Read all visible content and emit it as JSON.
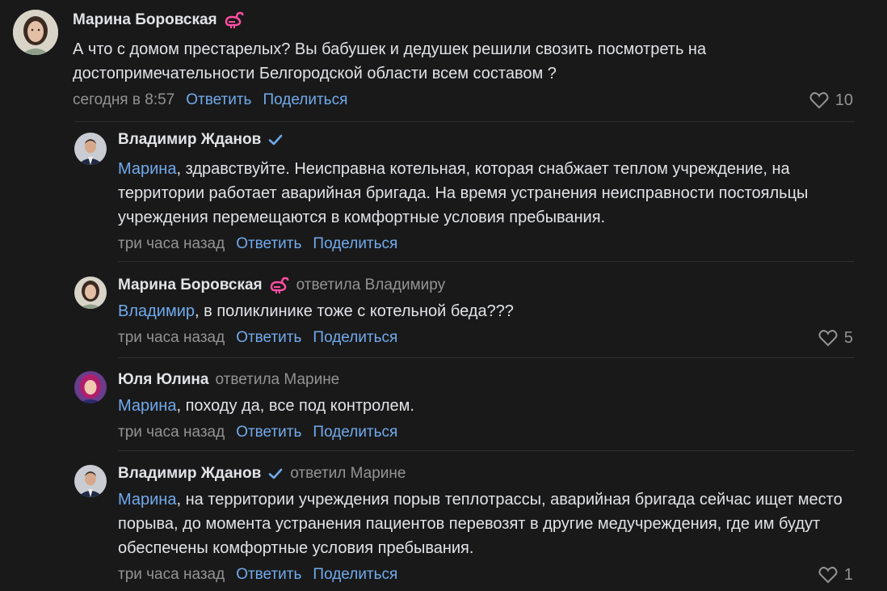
{
  "comments": [
    {
      "author": "Марина Боровская",
      "reply_to": "",
      "mention": "",
      "text": "А что с домом престарелых? Вы бабушек и дедушек решили свозить посмотреть на достопримечательности Белгородской области всем составом ?",
      "time": "сегодня в 8:57",
      "reply_label": "Ответить",
      "share_label": "Поделиться",
      "likes": "10"
    },
    {
      "author": "Владимир Жданов",
      "reply_to": "",
      "mention": "Марина",
      "text": ", здравствуйте. Неисправна котельная, которая снабжает теплом учреждение, на территории работает аварийная бригада. На время устранения неисправности постояльцы учреждения перемещаются в комфортные условия пребывания.",
      "time": "три часа назад",
      "reply_label": "Ответить",
      "share_label": "Поделиться",
      "likes": ""
    },
    {
      "author": "Марина Боровская",
      "reply_to": "ответила Владимиру",
      "mention": "Владимир",
      "text": ", в поликлинике тоже с котельной беда???",
      "time": "три часа назад",
      "reply_label": "Ответить",
      "share_label": "Поделиться",
      "likes": "5"
    },
    {
      "author": "Юля Юлина",
      "reply_to": "ответила Марине",
      "mention": "Марина",
      "text": ", походу да, все под контролем.",
      "time": "три часа назад",
      "reply_label": "Ответить",
      "share_label": "Поделиться",
      "likes": ""
    },
    {
      "author": "Владимир Жданов",
      "reply_to": "ответил Марине",
      "mention": "Марина",
      "text": ", на территории учреждения порыв теплотрассы, аварийная бригада сейчас ищет место порыва, до момента устранения пациентов перевозят в другие медучреждения, где им будут обеспечены комфортные условия пребывания.",
      "time": "три часа назад",
      "reply_label": "Ответить",
      "share_label": "Поделиться",
      "likes": "1"
    }
  ],
  "icons": {
    "like": "heart-icon",
    "verified": "verified-check-icon",
    "flamingo": "flamingo-emoji-icon"
  },
  "colors": {
    "background": "#19191a",
    "text": "#e1e3e6",
    "secondary": "#939393",
    "link": "#71aaeb",
    "flamingo": "#ff4fa3"
  }
}
